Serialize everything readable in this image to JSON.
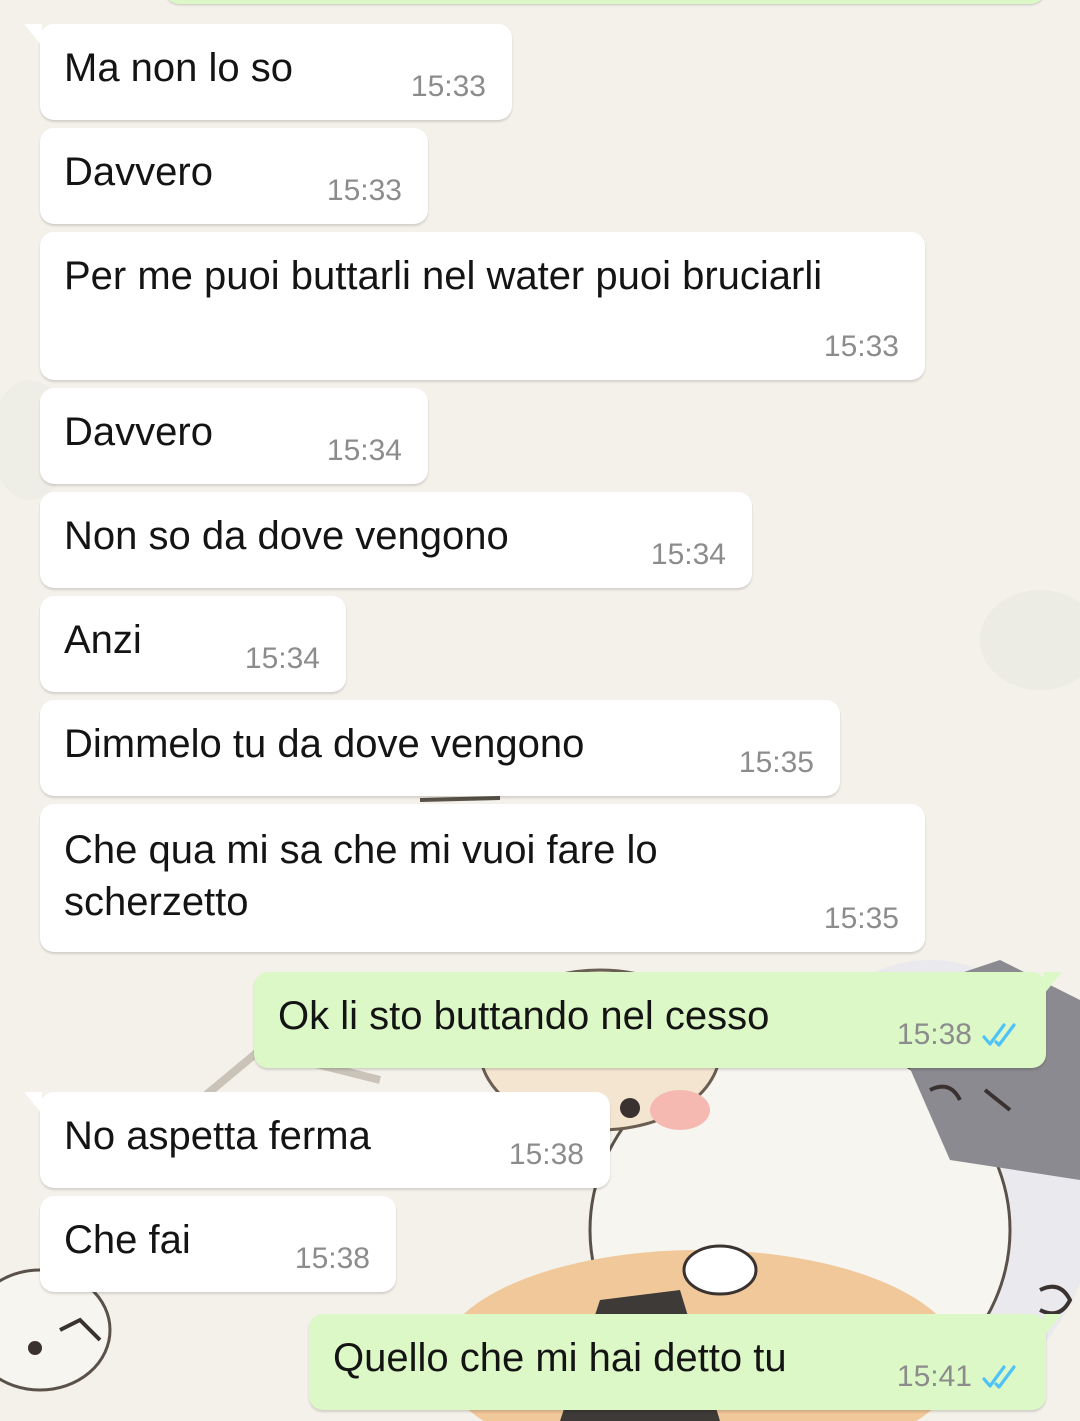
{
  "colors": {
    "incoming_bubble": "#ffffff",
    "outgoing_bubble": "#dcf8c6",
    "read_ticks": "#4fc3f7",
    "timestamp": "#8c8c8c"
  },
  "messages": [
    {
      "direction": "in",
      "text": "Ma non lo so",
      "time": "15:33"
    },
    {
      "direction": "in",
      "text": "Davvero",
      "time": "15:33"
    },
    {
      "direction": "in",
      "text": "Per me puoi buttarli nel water puoi bruciarli",
      "time": "15:33"
    },
    {
      "direction": "in",
      "text": "Davvero",
      "time": "15:34"
    },
    {
      "direction": "in",
      "text": "Non so da dove vengono",
      "time": "15:34"
    },
    {
      "direction": "in",
      "text": "Anzi",
      "time": "15:34"
    },
    {
      "direction": "in",
      "text": "Dimmelo tu da dove vengono",
      "time": "15:35"
    },
    {
      "direction": "in",
      "text_lines": [
        "Che qua mi sa che mi vuoi fare lo",
        "scherzetto"
      ],
      "time": "15:35"
    },
    {
      "direction": "out",
      "text": "Ok li sto buttando nel cesso",
      "time": "15:38",
      "status_icon": "double-check-read-icon"
    },
    {
      "direction": "in",
      "text": "No aspetta ferma",
      "time": "15:38"
    },
    {
      "direction": "in",
      "text": "Che fai",
      "time": "15:38"
    },
    {
      "direction": "out",
      "text": "Quello che mi hai detto tu",
      "time": "15:41",
      "status_icon": "double-check-read-icon"
    }
  ]
}
